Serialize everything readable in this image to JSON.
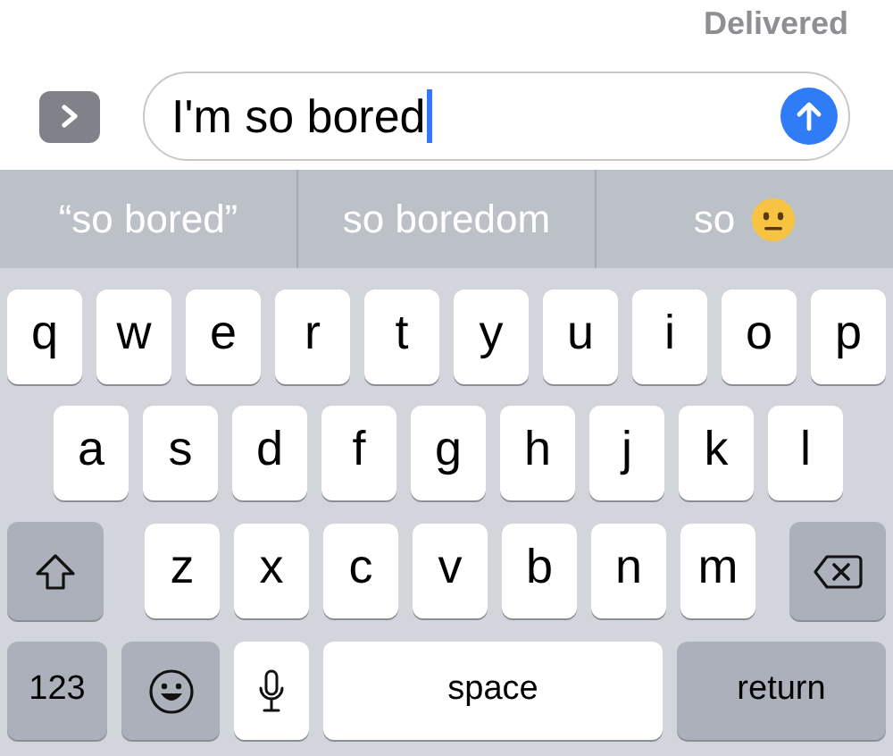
{
  "status": "Delivered",
  "message_field": {
    "value": "I'm so bored"
  },
  "suggestions": [
    {
      "text": "“so bored”",
      "kind": "text"
    },
    {
      "text": "so boredom",
      "kind": "text"
    },
    {
      "text": "so",
      "kind": "emoji"
    }
  ],
  "keyboard": {
    "rows": [
      [
        "q",
        "w",
        "e",
        "r",
        "t",
        "y",
        "u",
        "i",
        "o",
        "p"
      ],
      [
        "a",
        "s",
        "d",
        "f",
        "g",
        "h",
        "j",
        "k",
        "l"
      ],
      [
        "z",
        "x",
        "c",
        "v",
        "b",
        "n",
        "m"
      ]
    ],
    "numbers_key": "123",
    "space_key": "space",
    "return_key": "return"
  }
}
